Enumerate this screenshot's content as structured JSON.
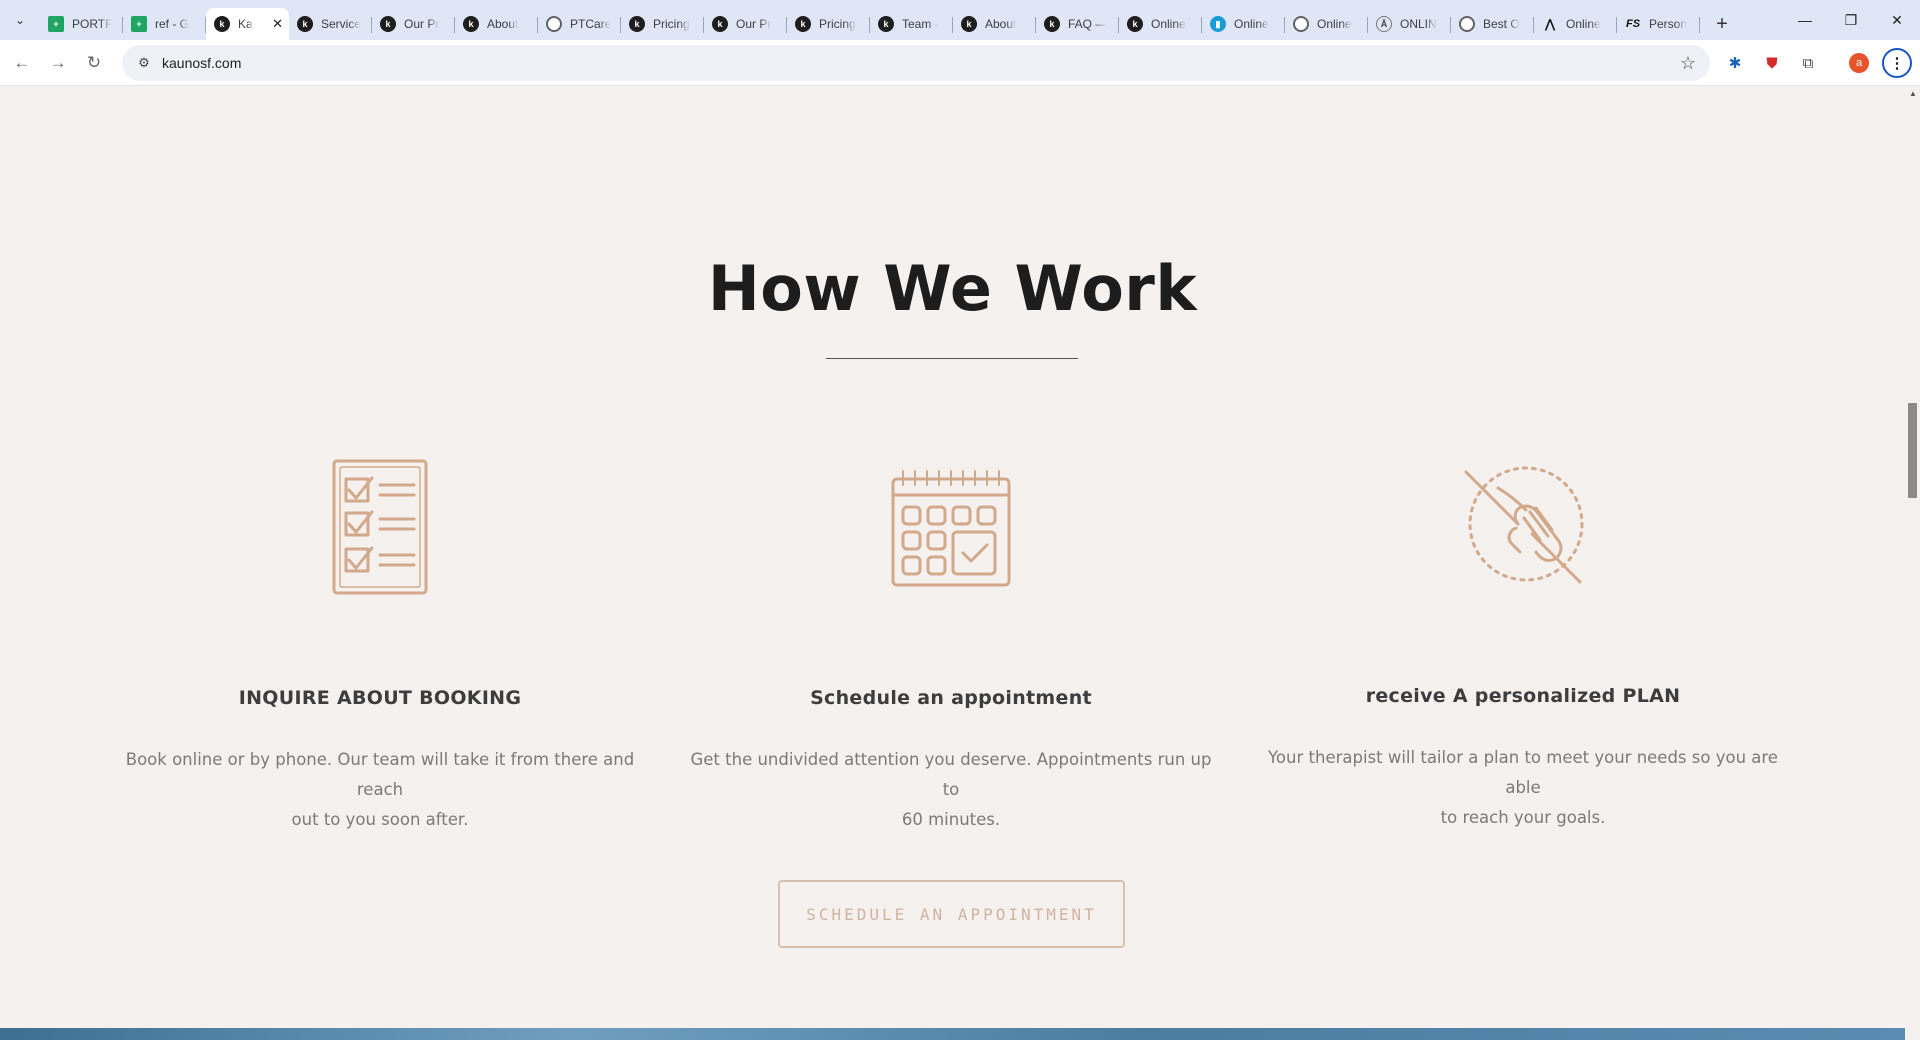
{
  "browser": {
    "tabs": [
      {
        "label": "PORTF",
        "icon": "sheets"
      },
      {
        "label": "ref - G",
        "icon": "sheets"
      },
      {
        "label": "Ka",
        "icon": "k",
        "active": true
      },
      {
        "label": "Service",
        "icon": "k"
      },
      {
        "label": "Our Pr",
        "icon": "k"
      },
      {
        "label": "About",
        "icon": "k"
      },
      {
        "label": "PTCare",
        "icon": "globe"
      },
      {
        "label": "Pricing",
        "icon": "k"
      },
      {
        "label": "Our Pr",
        "icon": "k"
      },
      {
        "label": "Pricing",
        "icon": "k"
      },
      {
        "label": "Team -",
        "icon": "k"
      },
      {
        "label": "About",
        "icon": "k"
      },
      {
        "label": "FAQ —",
        "icon": "k"
      },
      {
        "label": "Online",
        "icon": "k"
      },
      {
        "label": "Online",
        "icon": "chart"
      },
      {
        "label": "Online",
        "icon": "globe"
      },
      {
        "label": "ONLIN",
        "icon": "acorn"
      },
      {
        "label": "Best O",
        "icon": "globe"
      },
      {
        "label": "Online",
        "icon": "mtn"
      },
      {
        "label": "Person",
        "icon": "fs"
      }
    ],
    "url": "kaunosf.com",
    "profile_initial": "a"
  },
  "section": {
    "heading": "How We Work",
    "steps": [
      {
        "icon": "checklist-icon",
        "title": "INQUIRE ABOUT BOOKING",
        "line1": "Book online or by phone. Our team will take it from there and reach",
        "line2": "out to you soon after."
      },
      {
        "icon": "calendar-icon",
        "title": "Schedule an appointment",
        "line1": "Get the undivided attention you deserve. Appointments run up to",
        "line2": "60 minutes."
      },
      {
        "icon": "helping-hands-icon",
        "title": "receive A personalized PLAN",
        "line1": "Your therapist will tailor a plan to meet your needs so you are able",
        "line2": "to reach your goals."
      }
    ],
    "cta_label": "SCHEDULE AN APPOINTMENT"
  },
  "colors": {
    "accent_icon": "#d2a98a",
    "background": "#f5f1ef",
    "heading": "#1d1d1d"
  }
}
